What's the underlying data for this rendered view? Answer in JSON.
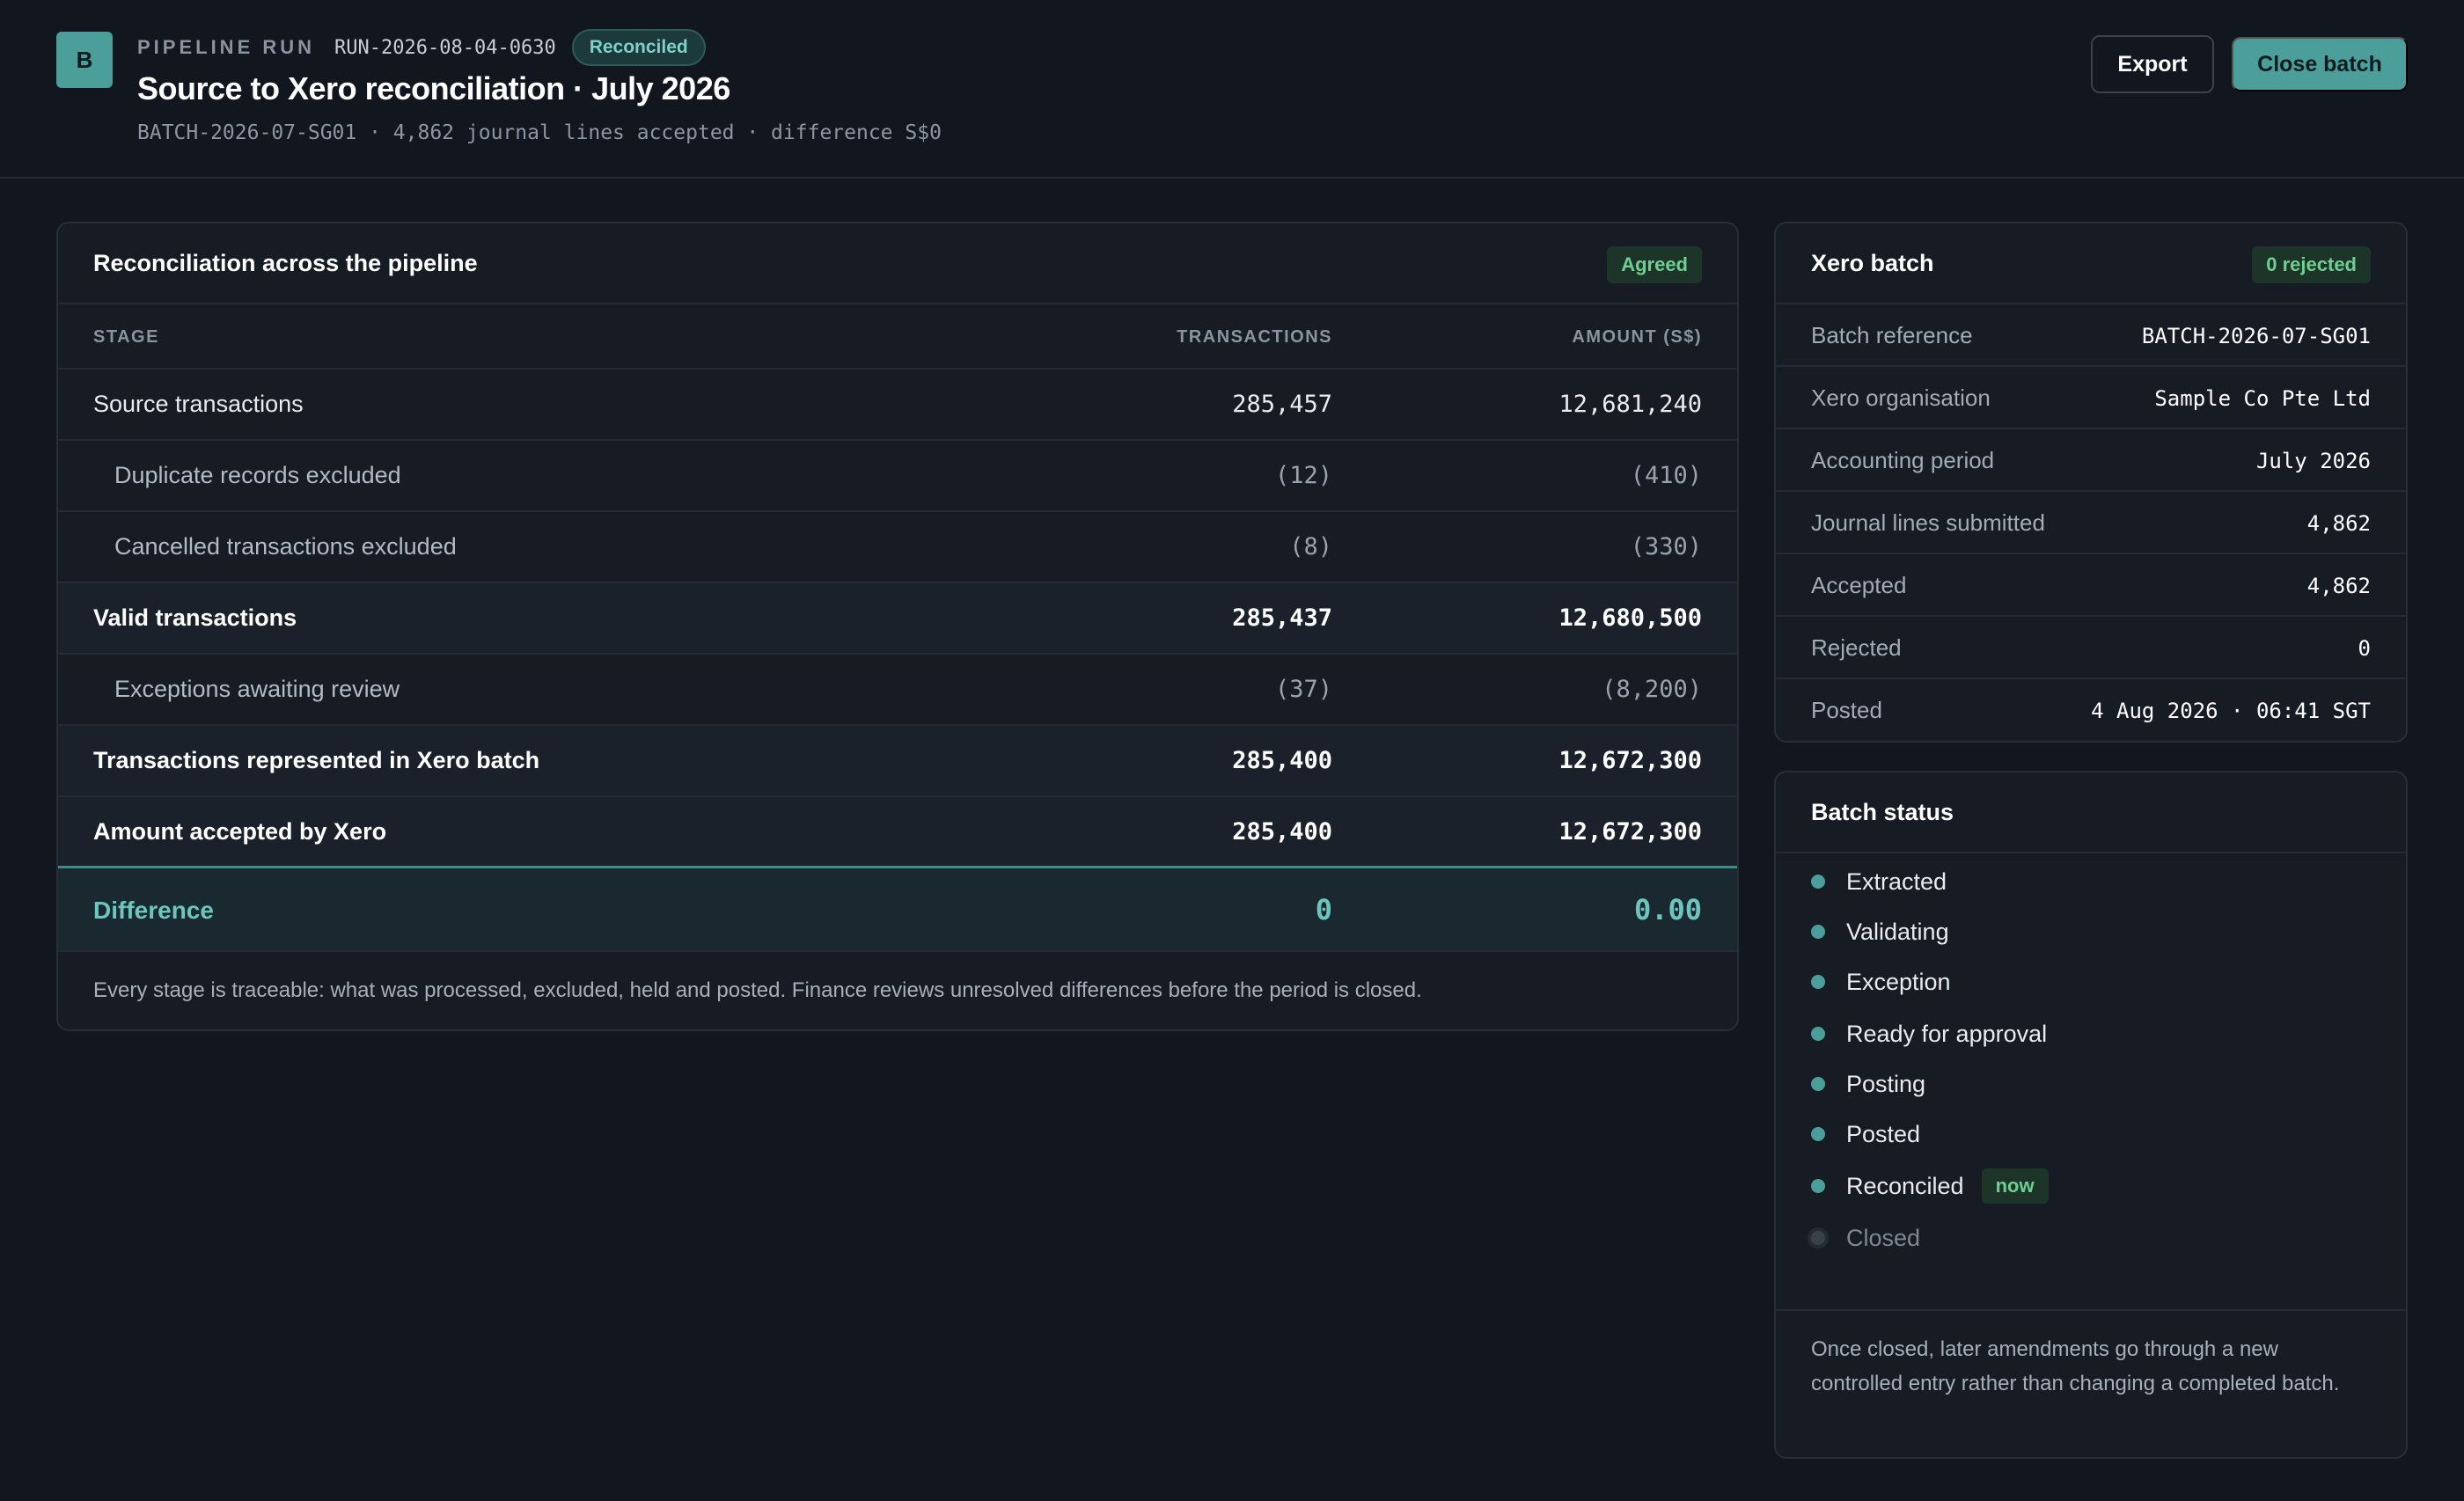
{
  "header": {
    "logo_letter": "B",
    "eyebrow": "PIPELINE RUN",
    "run_id": "RUN-2026-08-04-0630",
    "status_pill": "Reconciled",
    "title": "Source to Xero reconciliation · July 2026",
    "subline": "BATCH-2026-07-SG01 · 4,862 journal lines accepted · difference S$0",
    "export_label": "Export",
    "close_label": "Close batch"
  },
  "reconciliation": {
    "title": "Reconciliation across the pipeline",
    "badge": "Agreed",
    "columns": {
      "stage": "STAGE",
      "transactions": "TRANSACTIONS",
      "amount": "AMOUNT (S$)"
    },
    "rows": [
      {
        "label": "Source transactions",
        "transactions": "285,457",
        "amount": "12,681,240"
      },
      {
        "label": "Duplicate records excluded",
        "transactions": "(12)",
        "amount": "(410)"
      },
      {
        "label": "Cancelled transactions excluded",
        "transactions": "(8)",
        "amount": "(330)"
      },
      {
        "label": "Valid transactions",
        "transactions": "285,437",
        "amount": "12,680,500"
      },
      {
        "label": "Exceptions awaiting review",
        "transactions": "(37)",
        "amount": "(8,200)"
      },
      {
        "label": "Transactions represented in Xero batch",
        "transactions": "285,400",
        "amount": "12,672,300"
      },
      {
        "label": "Amount accepted by Xero",
        "transactions": "285,400",
        "amount": "12,672,300"
      }
    ],
    "difference": {
      "label": "Difference",
      "transactions": "0",
      "amount": "0.00"
    },
    "note": "Every stage is traceable: what was processed, excluded, held and posted. Finance reviews unresolved differences before the period is closed."
  },
  "xero_batch": {
    "title": "Xero batch",
    "badge": "0 rejected",
    "fields": [
      {
        "key": "Batch reference",
        "value": "BATCH-2026-07-SG01"
      },
      {
        "key": "Xero organisation",
        "value": "Sample Co Pte Ltd"
      },
      {
        "key": "Accounting period",
        "value": "July 2026"
      },
      {
        "key": "Journal lines submitted",
        "value": "4,862"
      },
      {
        "key": "Accepted",
        "value": "4,862"
      },
      {
        "key": "Rejected",
        "value": "0"
      },
      {
        "key": "Posted",
        "value": "4 Aug 2026 · 06:41 SGT"
      }
    ]
  },
  "batch_status": {
    "title": "Batch status",
    "steps": [
      {
        "label": "Extracted"
      },
      {
        "label": "Validating"
      },
      {
        "label": "Exception"
      },
      {
        "label": "Ready for approval"
      },
      {
        "label": "Posting"
      },
      {
        "label": "Posted"
      },
      {
        "label": "Reconciled",
        "badge": "now"
      },
      {
        "label": "Closed"
      }
    ],
    "note": "Once closed, later amendments go through a new controlled entry rather than changing a completed batch."
  },
  "colors": {
    "accent": "#4c9e9a",
    "background": "#12161e",
    "success": "#6fcf92"
  }
}
